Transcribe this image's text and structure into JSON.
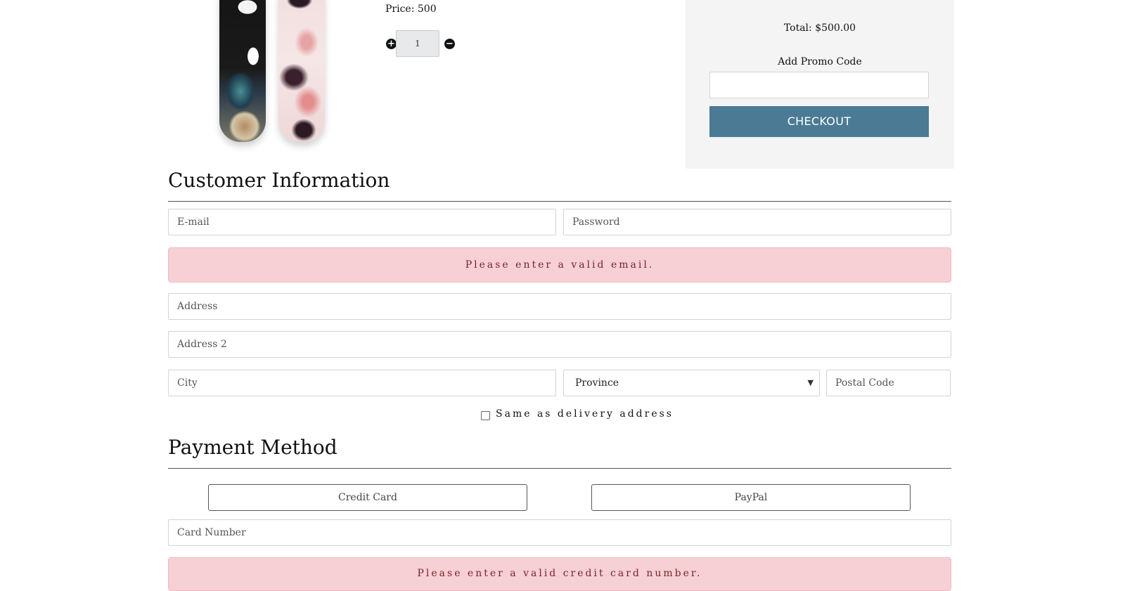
{
  "product": {
    "price_label": "Price: 500",
    "quantity": "1",
    "increase_symbol": "+",
    "decrease_symbol": "−"
  },
  "summary": {
    "total": "Total: $500.00",
    "promo_label": "Add Promo Code",
    "promo_value": "",
    "checkout_label": "CHECKOUT",
    "checkout_color": "#4a7a94"
  },
  "customer": {
    "title": "Customer Information",
    "email_placeholder": "E-mail",
    "password_placeholder": "Password",
    "email_error": "Please enter a valid email.",
    "address_placeholder": "Address",
    "address2_placeholder": "Address 2",
    "city_placeholder": "City",
    "province_selected": "Province",
    "postal_placeholder": "Postal Code",
    "same_as_delivery_label": "Same as delivery address",
    "same_as_delivery_checked": false
  },
  "payment": {
    "title": "Payment Method",
    "options": [
      "Credit Card",
      "PayPal"
    ],
    "card_number_placeholder": "Card Number",
    "card_error": "Please enter a valid credit card number."
  },
  "colors": {
    "error_bg": "#f6d0d5",
    "error_text": "#7a1f2b",
    "summary_bg": "#f4f4f4"
  }
}
